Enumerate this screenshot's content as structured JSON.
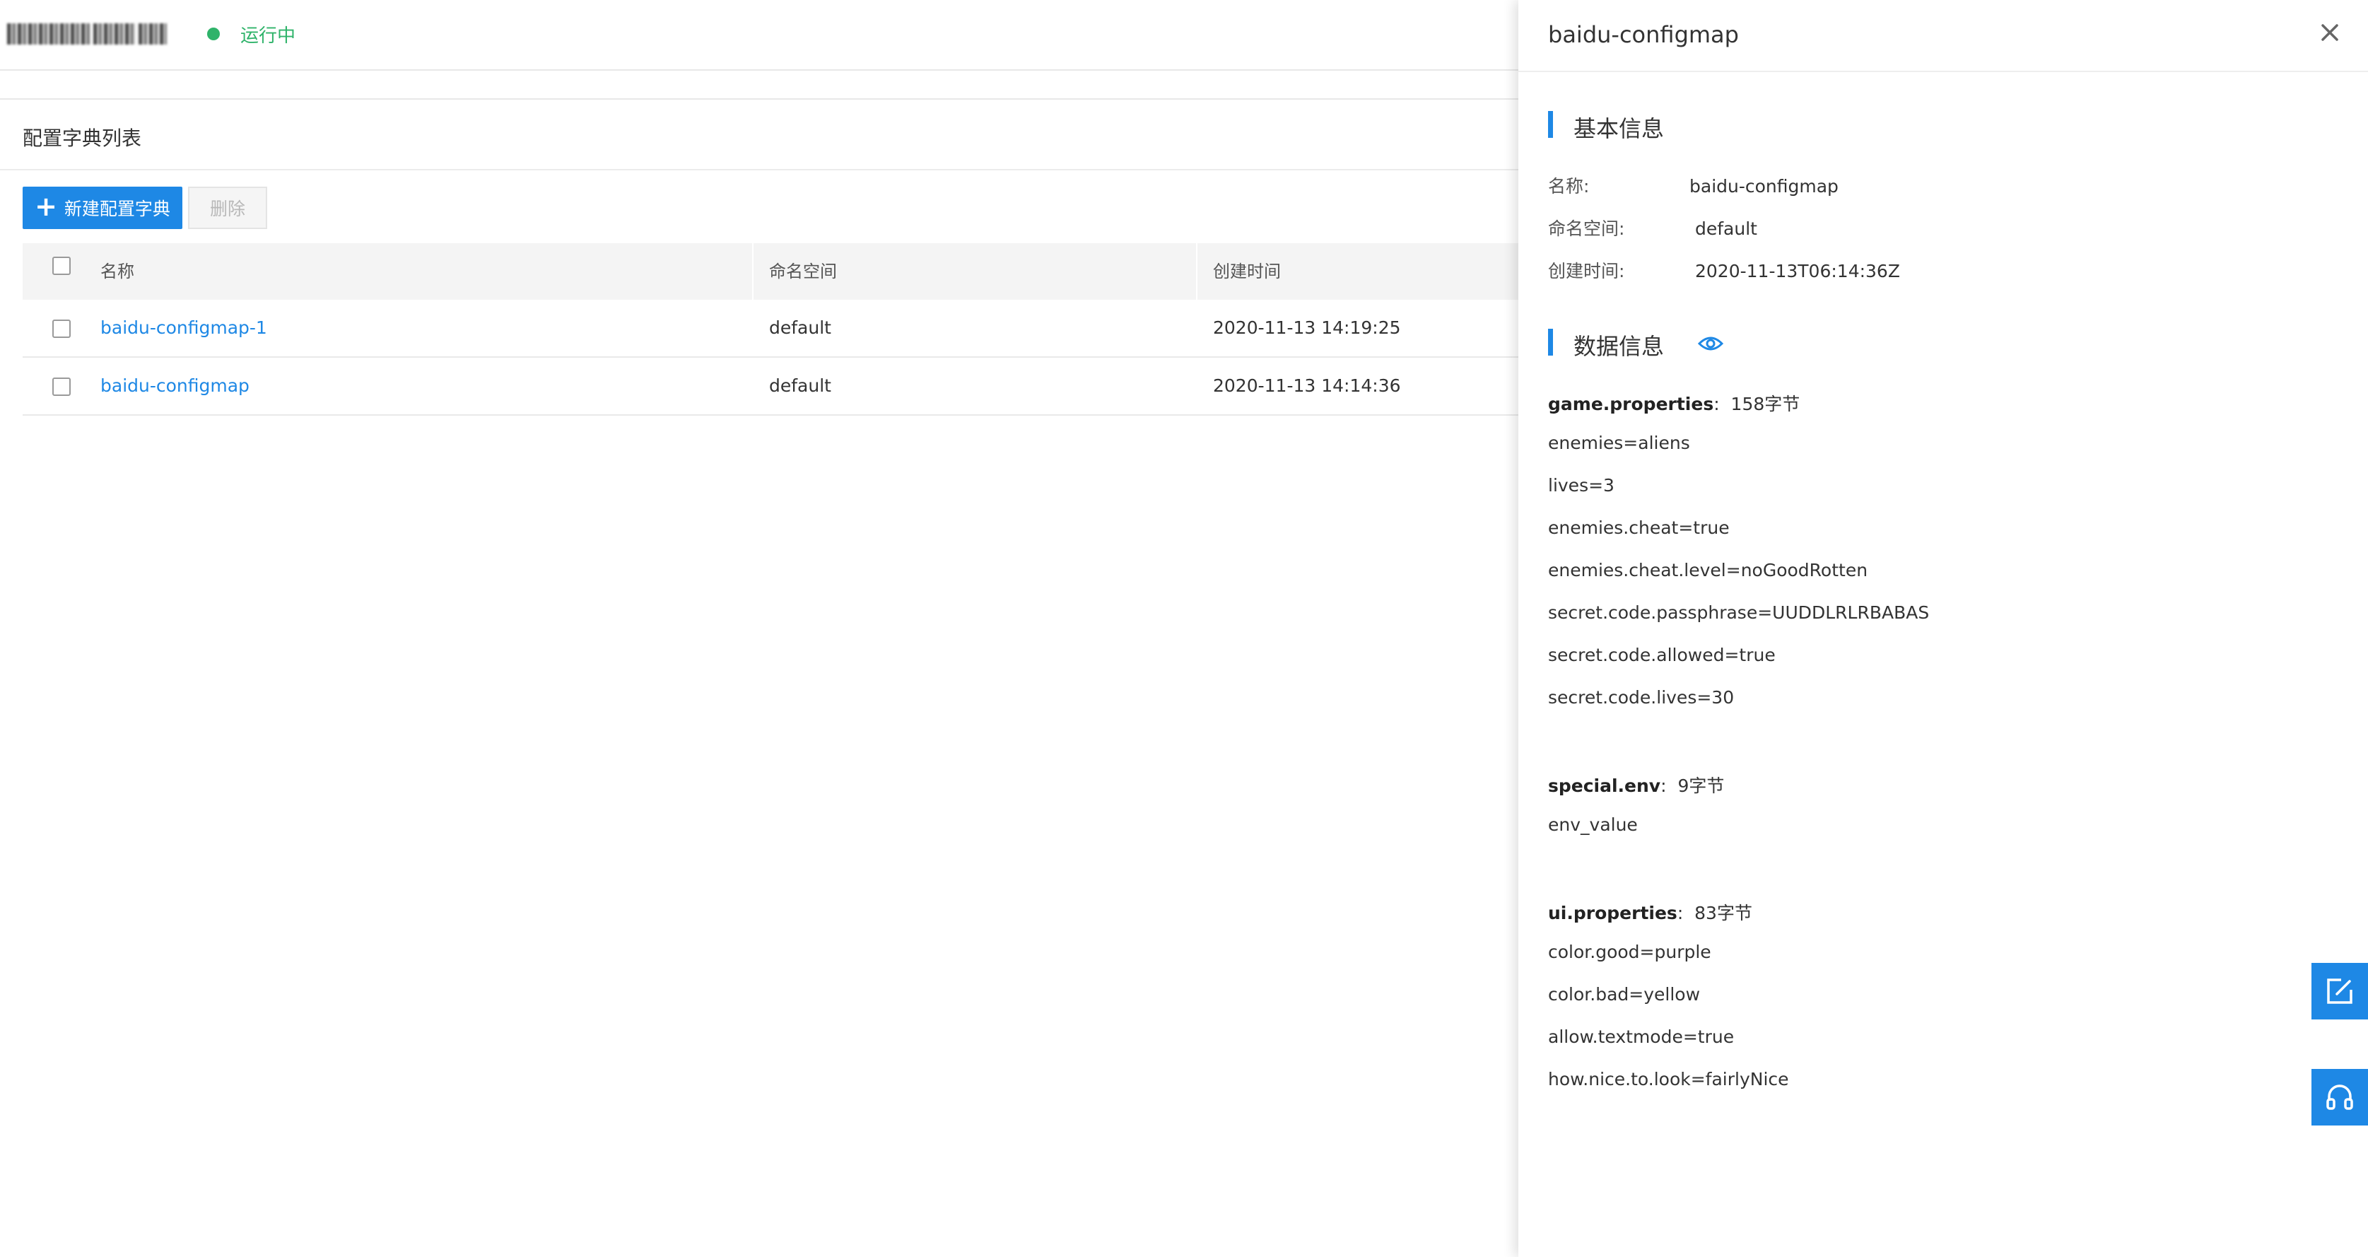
{
  "header": {
    "status_text": "运行中",
    "status_color": "#2fb36a"
  },
  "list": {
    "title": "配置字典列表",
    "new_button_label": "新建配置字典",
    "delete_button_label": "删除",
    "columns": [
      "名称",
      "命名空间",
      "创建时间"
    ],
    "rows": [
      {
        "name": "baidu-configmap-1",
        "namespace": "default",
        "created": "2020-11-13 14:19:25"
      },
      {
        "name": "baidu-configmap",
        "namespace": "default",
        "created": "2020-11-13 14:14:36"
      }
    ]
  },
  "drawer": {
    "title": "baidu-configmap",
    "basic_section_title": "基本信息",
    "basic": [
      {
        "key": "名称:",
        "value": "baidu-configmap"
      },
      {
        "key": "命名空间:",
        "value": "default"
      },
      {
        "key": "创建时间:",
        "value": "2020-11-13T06:14:36Z"
      }
    ],
    "data_section_title": "数据信息",
    "data": [
      {
        "key": "game.properties",
        "size": "158字节",
        "lines": [
          "enemies=aliens",
          "lives=3",
          "enemies.cheat=true",
          "enemies.cheat.level=noGoodRotten",
          "secret.code.passphrase=UUDDLRLRBABAS",
          "secret.code.allowed=true",
          "secret.code.lives=30"
        ]
      },
      {
        "key": "special.env",
        "size": "9字节",
        "lines": [
          "env_value"
        ]
      },
      {
        "key": "ui.properties",
        "size": "83字节",
        "lines": [
          "color.good=purple",
          "color.bad=yellow",
          "allow.textmode=true",
          "how.nice.to.look=fairlyNice"
        ]
      }
    ]
  },
  "colors": {
    "accent": "#1e88e5",
    "link": "#1e88e5"
  },
  "icons": {
    "close": "close-icon",
    "eye": "eye-icon",
    "edit": "edit-icon",
    "support": "headset-icon"
  }
}
